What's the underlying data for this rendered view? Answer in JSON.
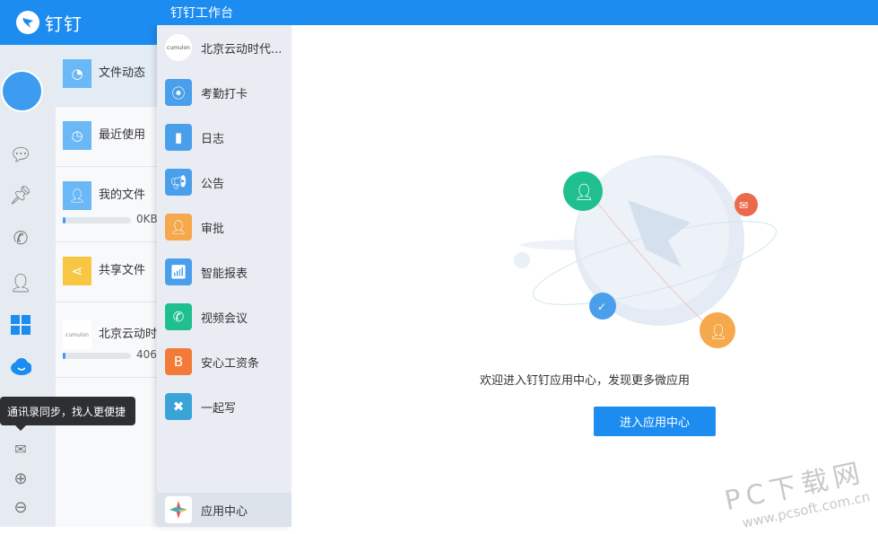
{
  "app": {
    "title": "钉钉"
  },
  "rail": {
    "tooltip": "通讯录同步，找人更便捷"
  },
  "files": [
    {
      "label": "文件动态",
      "icon": "compass-icon",
      "color": "#6ab8f5"
    },
    {
      "label": "最近使用",
      "icon": "clock-icon",
      "color": "#6ab8f5"
    },
    {
      "label": "我的文件",
      "icon": "user-icon",
      "color": "#6ab8f5",
      "usage": "0KB",
      "progress": 0.03
    },
    {
      "label": "共享文件",
      "icon": "share-icon",
      "color": "#f7c744"
    },
    {
      "label": "北京云动时代",
      "icon": "company-logo",
      "color": "#ffffff",
      "usage": "406",
      "progress": 0.03
    }
  ],
  "workbench": {
    "title": "钉钉工作台",
    "items": [
      {
        "label": "北京云动时代...",
        "icon": "company-logo",
        "color": "#ffffff"
      },
      {
        "label": "考勤打卡",
        "icon": "location-check-icon",
        "color": "#4a9fea"
      },
      {
        "label": "日志",
        "icon": "notebook-icon",
        "color": "#4a9fea"
      },
      {
        "label": "公告",
        "icon": "megaphone-icon",
        "color": "#4a9fea"
      },
      {
        "label": "审批",
        "icon": "stamp-icon",
        "color": "#f5a94c"
      },
      {
        "label": "智能报表",
        "icon": "chart-icon",
        "color": "#4a9fea"
      },
      {
        "label": "视频会议",
        "icon": "video-call-icon",
        "color": "#1fbf8f"
      },
      {
        "label": "安心工资条",
        "icon": "payslip-icon",
        "color": "#f37b37"
      },
      {
        "label": "一起写",
        "icon": "cowrite-icon",
        "color": "#3aa4d8"
      }
    ],
    "app_center": "应用中心"
  },
  "main": {
    "welcome": "欢迎进入钉钉应用中心，发现更多微应用",
    "enter_button": "进入应用中心"
  },
  "watermark": {
    "line1": "PC下载网",
    "line2": "www.pcsoft.com.cn"
  }
}
